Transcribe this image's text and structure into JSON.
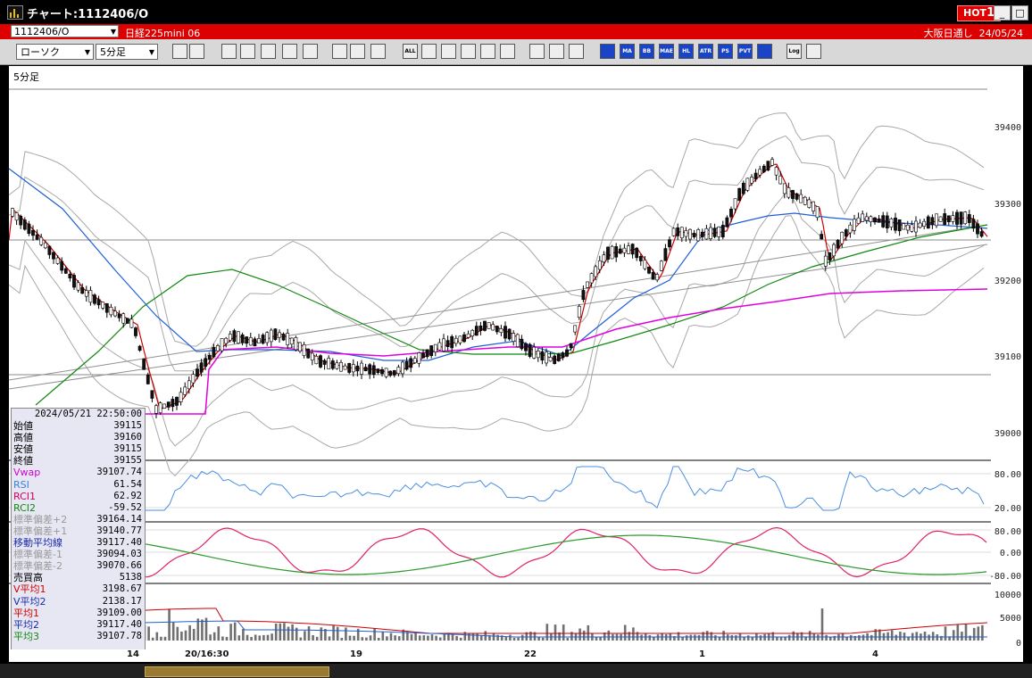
{
  "window": {
    "title": "チャート:1112406/O",
    "hot_label": "HOT",
    "hot_num": "1",
    "min_btn": "_",
    "max_btn": "□",
    "close_btn": "×"
  },
  "infobar": {
    "symbol_code": "1112406/O",
    "symbol_name": "日経225mini 06",
    "session": "大阪日通し",
    "date": "24/05/24"
  },
  "toolbar": {
    "chart_type": "ローソク",
    "interval": "5分足",
    "buttons": [
      "zoom",
      "grid",
      "bull",
      "search",
      "bars",
      "pin",
      "split",
      "warn",
      "box1",
      "box2",
      "all",
      "pen",
      "draw",
      "cursor",
      "arrow",
      "note",
      "trash",
      "settings",
      "tool",
      "palette",
      "tick",
      "MA",
      "BB",
      "MAE",
      "HL",
      "ATR",
      "PS",
      "PVT",
      "box",
      "Log",
      "export"
    ],
    "labels": {
      "all": "ALL",
      "ma": "MA",
      "bb": "BB",
      "mae": "MAE",
      "hl": "HL",
      "atr": "ATR",
      "ps": "PS",
      "pvt": "PVT",
      "log": "Log"
    }
  },
  "colors": {
    "candle_up": "#ffffff",
    "candle_down": "#111111",
    "ma_short": "#cc0000",
    "ma_mid": "#1f5fd6",
    "ma_long": "#118811",
    "vwap": "#e000e0",
    "bollinger": "#a8a8a8",
    "trend": "#909090",
    "rsi": "#4a8fe0",
    "rci1": "#e0206a",
    "rci2": "#2a9a2a",
    "volume": "#707070"
  },
  "panels": {
    "main_label": "5分足",
    "price_axis": [
      "39400",
      "39300",
      "39200",
      "39100",
      "39000"
    ],
    "rsi_axis": [
      "80.00",
      "20.00"
    ],
    "rci_axis": [
      "80.00",
      "0.00",
      "-80.00"
    ],
    "volume_axis": [
      "10000",
      "5000",
      "0"
    ],
    "x_axis": [
      "14",
      "20/16:30",
      "19",
      "22",
      "1",
      "4"
    ]
  },
  "data_panel": {
    "date": "2024/05/21 22:50:00",
    "rows": [
      {
        "label": "始値",
        "value": "39115",
        "color": "#000"
      },
      {
        "label": "高値",
        "value": "39160",
        "color": "#000"
      },
      {
        "label": "安値",
        "value": "39115",
        "color": "#000"
      },
      {
        "label": "終値",
        "value": "39155",
        "color": "#000"
      },
      {
        "label": "Vwap",
        "value": "39107.74",
        "color": "#d000d0"
      },
      {
        "label": "RSI",
        "value": "61.54",
        "color": "#3a7fd8"
      },
      {
        "label": "RCI1",
        "value": "62.92",
        "color": "#d0005a"
      },
      {
        "label": "RCI2",
        "value": "-59.52",
        "color": "#118811"
      },
      {
        "label": "標準偏差+2",
        "value": "39164.14",
        "color": "#999"
      },
      {
        "label": "標準偏差+1",
        "value": "39140.77",
        "color": "#999"
      },
      {
        "label": "移動平均線",
        "value": "39117.40",
        "color": "#1a2aa8"
      },
      {
        "label": "標準偏差-1",
        "value": "39094.03",
        "color": "#999"
      },
      {
        "label": "標準偏差-2",
        "value": "39070.66",
        "color": "#999"
      },
      {
        "label": "売買高",
        "value": "5138",
        "color": "#000"
      },
      {
        "label": "V平均1",
        "value": "3198.67",
        "color": "#d00000"
      },
      {
        "label": "V平均2",
        "value": "2138.17",
        "color": "#1a2aa8"
      },
      {
        "label": "平均1",
        "value": "39109.00",
        "color": "#d00000"
      },
      {
        "label": "平均2",
        "value": "39117.40",
        "color": "#1a2aa8"
      },
      {
        "label": "平均3",
        "value": "39107.78",
        "color": "#118811"
      }
    ]
  }
}
